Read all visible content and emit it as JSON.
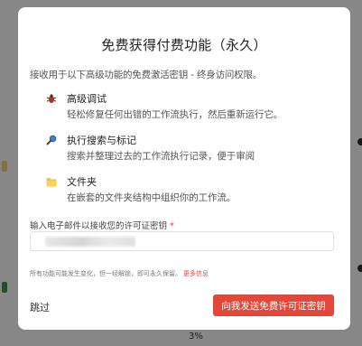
{
  "background": {
    "bottom_text": "3%"
  },
  "modal": {
    "title": "免费获得付费功能（永久）",
    "intro": "接收用于以下高级功能的免费激活密钥 - 终身访问权限。",
    "features": [
      {
        "icon": "bug-icon",
        "name": "高级调试",
        "desc": "轻松修复任何出错的工作流执行，然后重新运行它。"
      },
      {
        "icon": "magnifier-icon",
        "name": "执行搜索与标记",
        "desc": "搜索并整理过去的工作流执行记录，便于审阅"
      },
      {
        "icon": "folder-icon",
        "name": "文件夹",
        "desc": "在嵌套的文件夹结构中组织你的工作流。"
      }
    ],
    "email": {
      "label": "输入电子邮件以接收您的许可证密钥",
      "required_mark": "*",
      "value": "",
      "placeholder": ""
    },
    "note": "所有功能可能发生变化，但一经解锁，即可永久保留。",
    "note_link": "更多信息",
    "skip_label": "跳过",
    "submit_label": "向我发送免费许可证密钥"
  },
  "colors": {
    "accent": "#e2483a",
    "overlay": "rgba(0,0,0,0.42)"
  }
}
